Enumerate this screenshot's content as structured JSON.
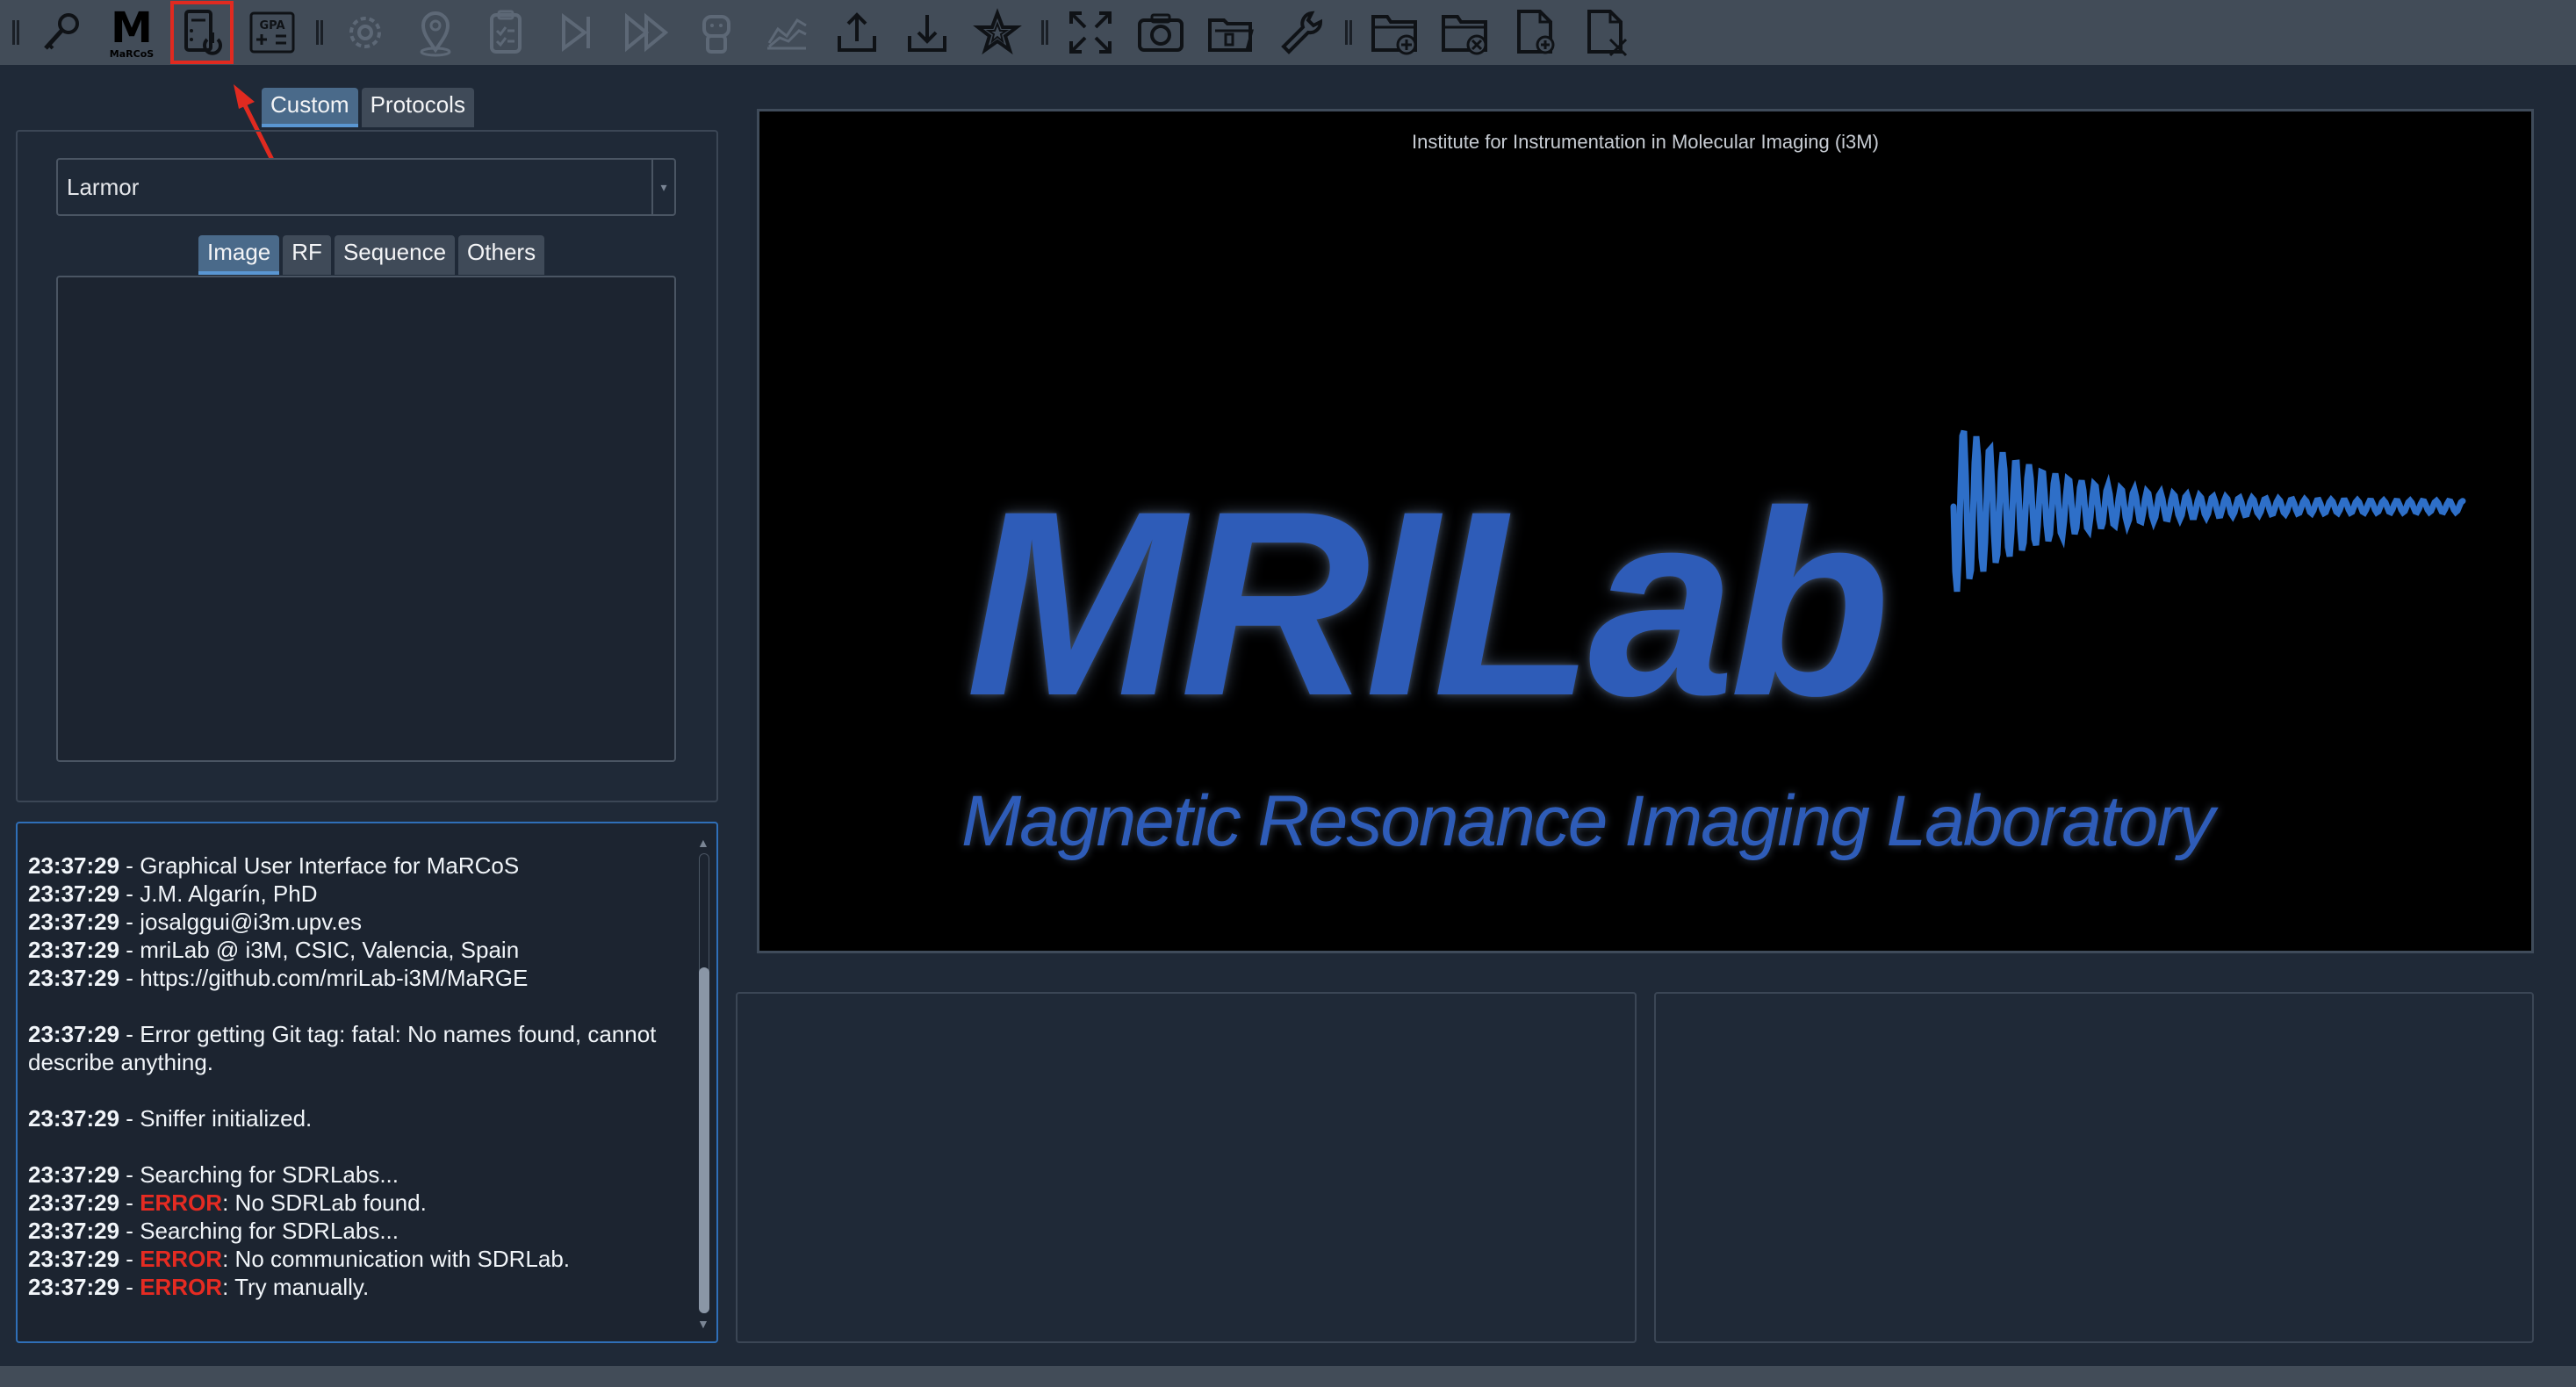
{
  "toolbar": {
    "items": [
      {
        "name": "key-icon"
      },
      {
        "name": "marcos-logo",
        "label": "M",
        "sublabel": "MaRCoS"
      },
      {
        "name": "console-power-icon",
        "active": true
      },
      {
        "name": "gpa-icon",
        "label": "GPA"
      },
      {
        "name": "gear-icon"
      },
      {
        "name": "location-pin-icon"
      },
      {
        "name": "clipboard-check-icon"
      },
      {
        "name": "play-next-icon"
      },
      {
        "name": "fast-forward-icon"
      },
      {
        "name": "robot-icon"
      },
      {
        "name": "chart-line-icon"
      },
      {
        "name": "upload-icon"
      },
      {
        "name": "download-icon"
      },
      {
        "name": "star-icon"
      },
      {
        "name": "fullscreen-icon"
      },
      {
        "name": "camera-icon"
      },
      {
        "name": "folder-open-icon"
      },
      {
        "name": "wrench-icon"
      },
      {
        "name": "folder-add-icon"
      },
      {
        "name": "folder-remove-icon"
      },
      {
        "name": "file-add-icon"
      },
      {
        "name": "file-remove-icon"
      }
    ]
  },
  "sequence_panel": {
    "tabs": [
      "Custom",
      "Protocols"
    ],
    "active_tab": "Custom",
    "selected_sequence": "Larmor",
    "param_tabs": [
      "Image",
      "RF",
      "Sequence",
      "Others"
    ],
    "active_param_tab": "Image"
  },
  "console": {
    "lines": [
      {
        "time": "23:37:29",
        "text": "Graphical User Interface for MaRCoS"
      },
      {
        "time": "23:37:29",
        "text": "J.M. Algarín, PhD"
      },
      {
        "time": "23:37:29",
        "text": "josalggui@i3m.upv.es"
      },
      {
        "time": "23:37:29",
        "text": "mriLab @ i3M, CSIC, Valencia, Spain"
      },
      {
        "time": "23:37:29",
        "text": "https://github.com/mriLab-i3M/MaRGE"
      },
      {
        "gap": true
      },
      {
        "time": "23:37:29",
        "text": "Error getting Git tag: fatal: No names found, cannot",
        "cont": "describe anything."
      },
      {
        "gap": true
      },
      {
        "time": "23:37:29",
        "text": "Sniffer initialized."
      },
      {
        "gap": true
      },
      {
        "time": "23:37:29",
        "text": "Searching for SDRLabs..."
      },
      {
        "time": "23:37:29",
        "error": "ERROR",
        "text": ": No SDRLab found."
      },
      {
        "time": "23:37:29",
        "text": "Searching for SDRLabs..."
      },
      {
        "time": "23:37:29",
        "error": "ERROR",
        "text": ": No communication with SDRLab."
      },
      {
        "time": "23:37:29",
        "error": "ERROR",
        "text": ": Try manually."
      }
    ]
  },
  "image_panel": {
    "institute": "Institute for Instrumentation in Molecular Imaging (i3M)",
    "logo_title": "MRILab",
    "logo_subtitle": "Magnetic Resonance Imaging Laboratory"
  },
  "colors": {
    "accent": "#2e5cb8",
    "error": "#e52b22",
    "highlight": "#e02a20"
  }
}
